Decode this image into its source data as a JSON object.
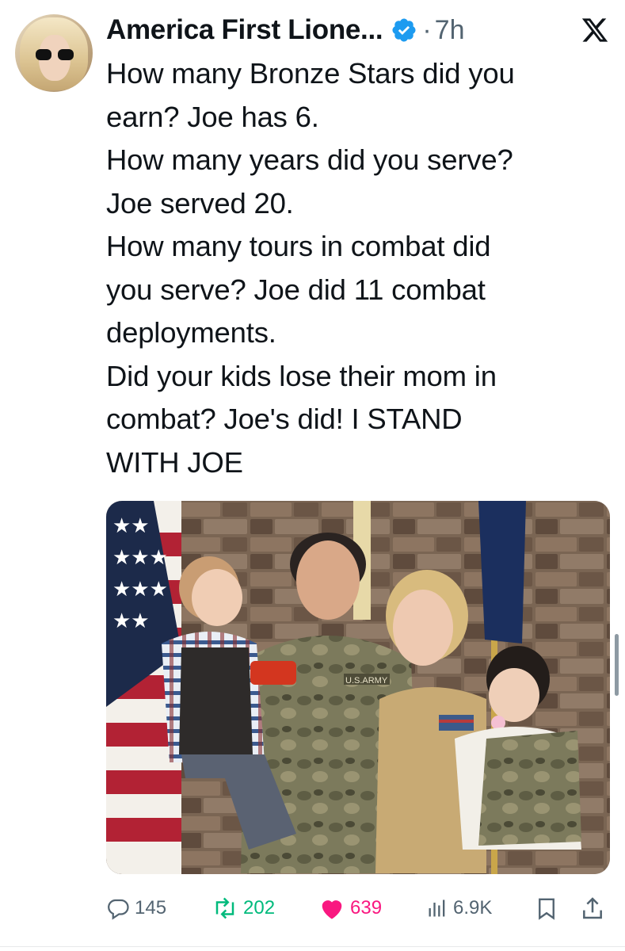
{
  "author": {
    "display_name": "America First Lione...",
    "time_ago": "7h",
    "separator": "·"
  },
  "tweet": {
    "text": "How many Bronze Stars did you\nearn? Joe has 6.\nHow many years did you serve?\nJoe served 20.\nHow many tours in combat did\nyou serve? Joe did 11 combat\ndeployments.\nDid your kids lose their mom in\ncombat? Joe's did! I STAND\nWITH JOE"
  },
  "media": {
    "patch_text": "U.S.ARMY"
  },
  "actions": {
    "replies": "145",
    "reposts": "202",
    "likes": "639",
    "views": "6.9K"
  },
  "colors": {
    "verified": "#1d9bf0",
    "repost": "#00ba7c",
    "like": "#f91880",
    "muted": "#536471"
  },
  "icons": [
    "verified-badge-icon",
    "x-logo-icon",
    "reply-icon",
    "repost-icon",
    "heart-icon",
    "views-icon",
    "bookmark-icon",
    "share-icon"
  ]
}
